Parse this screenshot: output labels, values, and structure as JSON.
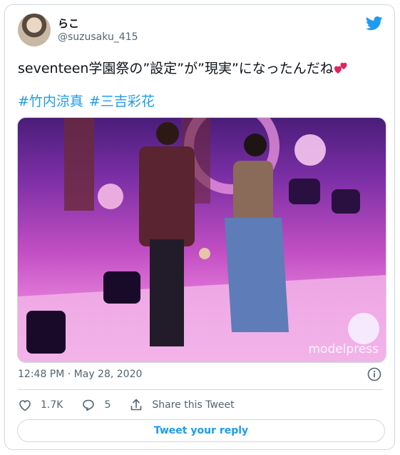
{
  "author": {
    "display_name": "らこ",
    "handle": "@suzusaku_415"
  },
  "tweet": {
    "text": "seventeen学園祭の”設定”が”現実”になったんだね",
    "hashtags": [
      "#竹内涼真",
      "#三吉彩花"
    ],
    "media_watermark": "modelpress",
    "timestamp": "12:48 PM · May 28, 2020"
  },
  "actions": {
    "likes": "1.7K",
    "replies": "5",
    "share_label": "Share this Tweet"
  },
  "reply_button_label": "Tweet your reply",
  "colors": {
    "accent": "#1d9bf0",
    "border": "#cfd9de",
    "muted_text": "#536471",
    "emoji_heart": "#e0245e"
  },
  "icons": [
    "twitter-bird-icon",
    "info-icon",
    "heart-icon",
    "reply-icon",
    "share-icon",
    "two-hearts-emoji"
  ]
}
